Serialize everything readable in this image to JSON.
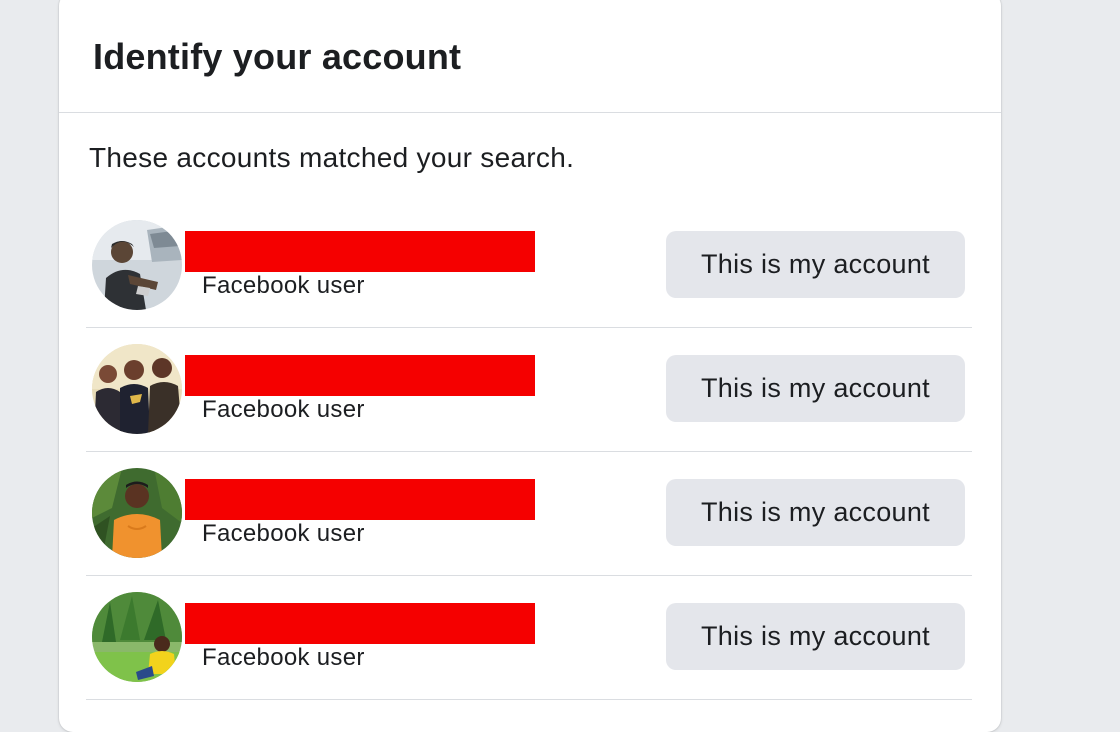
{
  "card": {
    "title": "Identify your account",
    "intro": "These accounts matched your search."
  },
  "results": [
    {
      "subtitle": "Facebook user",
      "button_label": "This is my account",
      "redacted_color": "#f50000"
    },
    {
      "subtitle": "Facebook user",
      "button_label": "This is my account",
      "redacted_color": "#f50000"
    },
    {
      "subtitle": "Facebook user",
      "button_label": "This is my account",
      "redacted_color": "#f50000"
    },
    {
      "subtitle": "Facebook user",
      "button_label": "This is my account",
      "redacted_color": "#f50000"
    }
  ],
  "colors": {
    "background": "#e9ebee",
    "card": "#ffffff",
    "button": "#e4e6eb",
    "text": "#1c1e21"
  }
}
